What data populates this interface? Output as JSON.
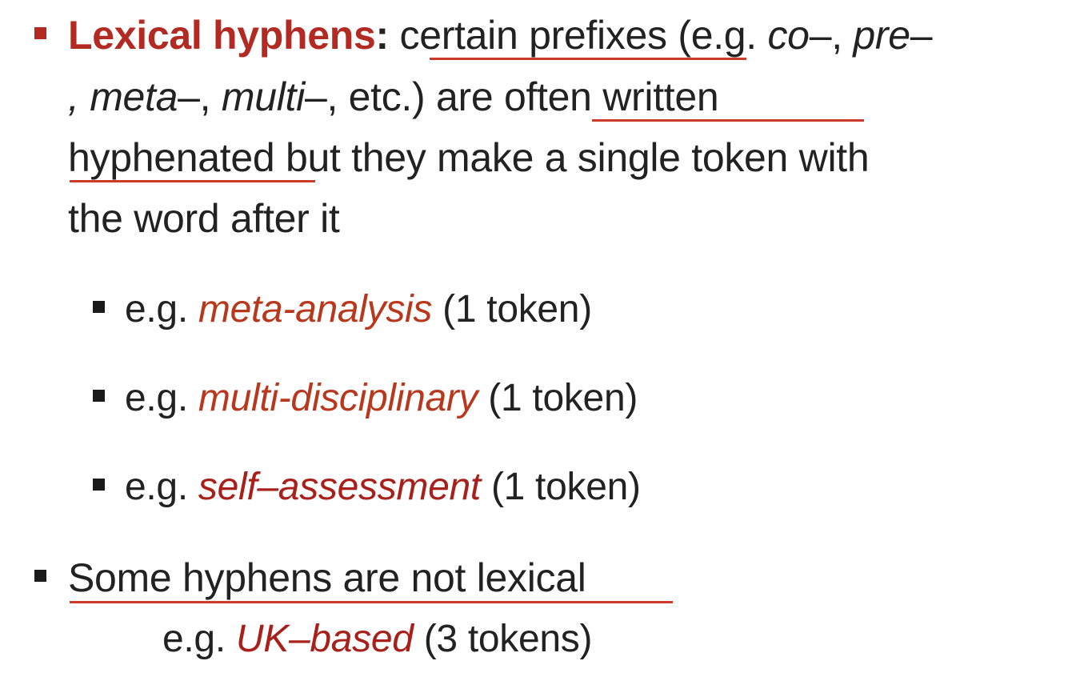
{
  "bullet1": {
    "term": "Lexical hyphens",
    "colon": ":",
    "phrase1": "certain prefixes",
    "text1": " (e.g. ",
    "ex_co": "co",
    "dash1": "–, ",
    "ex_pre": "pre",
    "dash2": "–",
    "line2_lead": ", ",
    "ex_meta": "meta",
    "dash3": "–, ",
    "ex_multi": "multi",
    "dash4": "–",
    "text2": ", etc.) are ",
    "phrase2": "often written",
    "phrase3": "hyphenated",
    "text3": " but they make a single token with",
    "text4": "the word after it"
  },
  "examples": [
    {
      "prefix": "e.g. ",
      "word": "meta-analysis",
      "suffix": " (1 token)"
    },
    {
      "prefix": "e.g. ",
      "word": "multi-disciplinary",
      "suffix": " (1 token)"
    },
    {
      "prefix": "e.g. ",
      "word": "self–assessment",
      "suffix": " (1 token)"
    }
  ],
  "bullet2": {
    "text": "Some hyphens are not lexical",
    "ex_prefix": "e.g. ",
    "ex_word": "UK–based",
    "ex_suffix": " (3 tokens)"
  }
}
